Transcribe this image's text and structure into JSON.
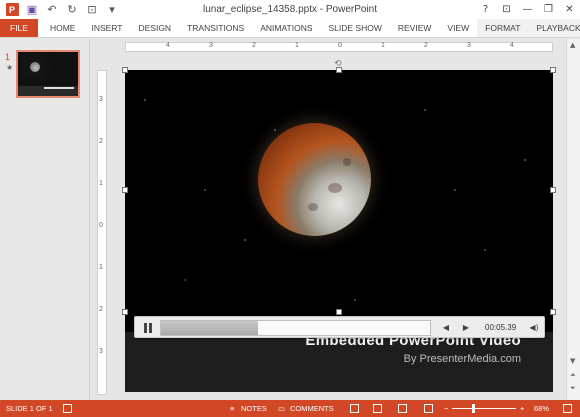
{
  "window": {
    "title": "lunar_eclipse_14358.pptx - PowerPoint",
    "help": "?",
    "minimize": "—",
    "restore": "❐",
    "close": "✕"
  },
  "qat": {
    "save_icon": "💾",
    "undo_icon": "↶",
    "redo_icon": "↻",
    "present_icon": "⊡",
    "customize_icon": "▾"
  },
  "tabs": [
    "FILE",
    "HOME",
    "INSERT",
    "DESIGN",
    "TRANSITIONS",
    "ANIMATIONS",
    "SLIDE SHOW",
    "REVIEW",
    "VIEW",
    "FORMAT",
    "PLAYBACK"
  ],
  "thumbnails": {
    "number": "1",
    "star": "★"
  },
  "ruler": {
    "h_ticks": [
      "4",
      "3",
      "2",
      "1",
      "0",
      "1",
      "2",
      "3",
      "4"
    ],
    "v_ticks": [
      "3",
      "2",
      "1",
      "0",
      "1",
      "2",
      "3"
    ]
  },
  "slide": {
    "title": "Embedded PowerPoint Video",
    "subtitle": "By PresenterMedia.com"
  },
  "player": {
    "progress": 0.36,
    "back_icon": "◀",
    "forward_icon": "▶",
    "time": "00:05.39",
    "volume_icon": "🔊"
  },
  "status": {
    "slide_info": "SLIDE 1 OF 1",
    "notes": "NOTES",
    "comments": "COMMENTS",
    "zoom": "68%",
    "zoom_out": "−",
    "zoom_in": "+"
  },
  "colors": {
    "accent": "#d24726"
  }
}
